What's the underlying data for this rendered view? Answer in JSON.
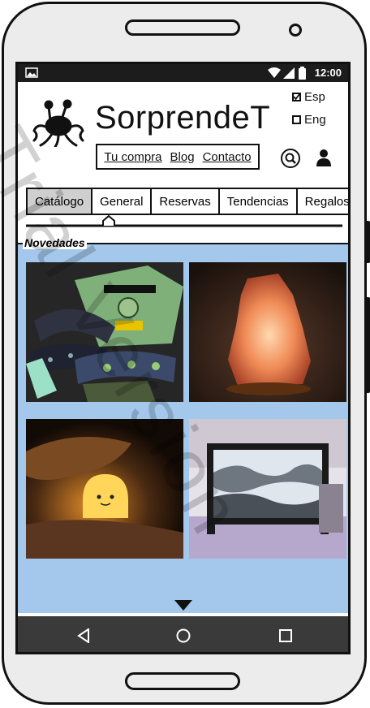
{
  "status": {
    "time": "12:00"
  },
  "brand": {
    "name": "SorprendeT"
  },
  "languages": [
    {
      "label": "Esp",
      "checked": true
    },
    {
      "label": "Eng",
      "checked": false
    }
  ],
  "top_nav": {
    "cart": "Tu compra",
    "blog": "Blog",
    "contact": "Contacto"
  },
  "tabs": [
    "Catálogo",
    "General",
    "Reservas",
    "Tendencias",
    "Regalos"
  ],
  "section": {
    "title": "Novedades"
  },
  "products": [
    {
      "image": "mandalorian-socks"
    },
    {
      "image": "salt-lamp"
    },
    {
      "image": "ghost-night-light"
    },
    {
      "image": "sand-art-frame"
    }
  ],
  "watermark": "Trial Version",
  "colors": {
    "content_bg": "#a3c8ec",
    "status_bar": "#1c1c1c",
    "nav_bar": "#3a3a3a",
    "active_tab": "#cfcfcf"
  }
}
